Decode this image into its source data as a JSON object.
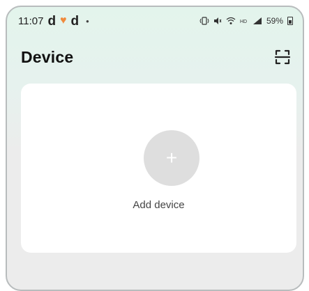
{
  "status_bar": {
    "time": "11:07",
    "notif_d1": "d",
    "notif_d2": "d",
    "notif_dot": "•",
    "battery_percent": "59%",
    "icons": [
      "vibrate-icon",
      "mute-icon",
      "wifi-icon",
      "hd-icon",
      "signal-icon",
      "battery-icon"
    ]
  },
  "header": {
    "title": "Device",
    "scan_icon": "scan-icon"
  },
  "main": {
    "add_device_label": "Add device",
    "add_icon": "plus-icon"
  },
  "colors": {
    "header_bg": "#e3f4ec",
    "page_bg": "#ececec",
    "card_bg": "#ffffff",
    "add_circle": "#dedede"
  }
}
